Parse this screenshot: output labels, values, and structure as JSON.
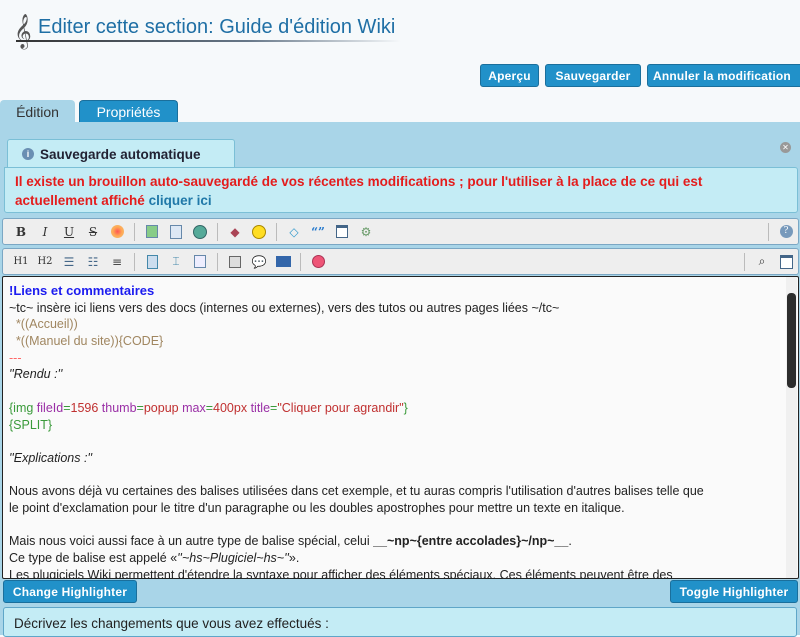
{
  "header": {
    "title": "Editer cette section: Guide d'édition Wiki"
  },
  "actions": {
    "preview": "Aperçu",
    "save": "Sauvegarder",
    "cancel": "Annuler la modification"
  },
  "tabs": [
    {
      "label": "Édition",
      "active": true
    },
    {
      "label": "Propriétés",
      "active": false
    }
  ],
  "autosave": {
    "title": "Sauvegarde automatique",
    "message": "Il existe un brouillon auto-sauvegardé de vos récentes modifications ; pour l'utiliser à la place de ce qui est actuellement affiché",
    "link": "cliquer ici"
  },
  "toolbar1": [
    "bold-icon",
    "italic-icon",
    "underline-icon",
    "strikethrough-icon",
    "color-palette-icon",
    "image-icon",
    "file-gallery-icon",
    "link-icon",
    "cube-icon",
    "smiley-icon",
    "code-icon",
    "quote-icon",
    "box-icon",
    "plugin-icon",
    "help-icon"
  ],
  "toolbar2": [
    "heading1-icon",
    "heading2-icon",
    "bullet-list-icon",
    "numbered-list-icon",
    "align-icon",
    "page-icon",
    "page-break-icon",
    "table-icon",
    "split-icon",
    "comment-icon",
    "html-icon",
    "special-char-icon",
    "find-replace-icon",
    "fullscreen-icon"
  ],
  "toolbar_labels": {
    "b": "B",
    "i": "I",
    "u": "U",
    "s": "S",
    "h1": "H1",
    "h2": "H2"
  },
  "editor": {
    "l1": "!Liens et commentaires",
    "l2": "~tc~ insère ici liens vers des docs (internes ou externes), vers des tutos ou autres pages liées ~/tc~",
    "l3": "  *((Accueil))",
    "l4": "  *((Manuel du site)){CODE}",
    "l5": "---",
    "l6": "''Rendu :''",
    "l8a": "{img ",
    "l8b": "fileId",
    "l8c": "=",
    "l8d": "1596",
    "l8e": " thumb",
    "l8f": "=",
    "l8g": "popup",
    "l8h": " max",
    "l8i": "=",
    "l8j": "400px",
    "l8k": " title",
    "l8l": "=",
    "l8m": "\"Cliquer pour agrandir\"",
    "l8n": "}",
    "l9": "{SPLIT}",
    "l11": "''Explications :''",
    "l13": "Nous avons déjà vu certaines des balises utilisées dans cet exemple, et tu auras compris l'utilisation d'autres balises telle que",
    "l14": "le point d'exclamation pour le titre d'un paragraphe ou les doubles apostrophes pour mettre un texte en italique.",
    "l16a": "Mais nous voici aussi face à un autre type de balise spécial, celui ",
    "l16b": "__~np~{entre accolades}~/np~__",
    ".": ".",
    "l17a": "Ce type de balise est appelé «",
    "l17b": "''~hs~Plugiciel~hs~''",
    "l17c": "».",
    "l18": "Les plugiciels Wiki permettent d'étendre la syntaxe pour afficher des éléments spéciaux. Ces éléments peuvent être des"
  },
  "highlighter": {
    "change": "Change Highlighter",
    "toggle": "Toggle Highlighter"
  },
  "description": {
    "label": "Décrivez les changements que vous avez effectués :"
  }
}
